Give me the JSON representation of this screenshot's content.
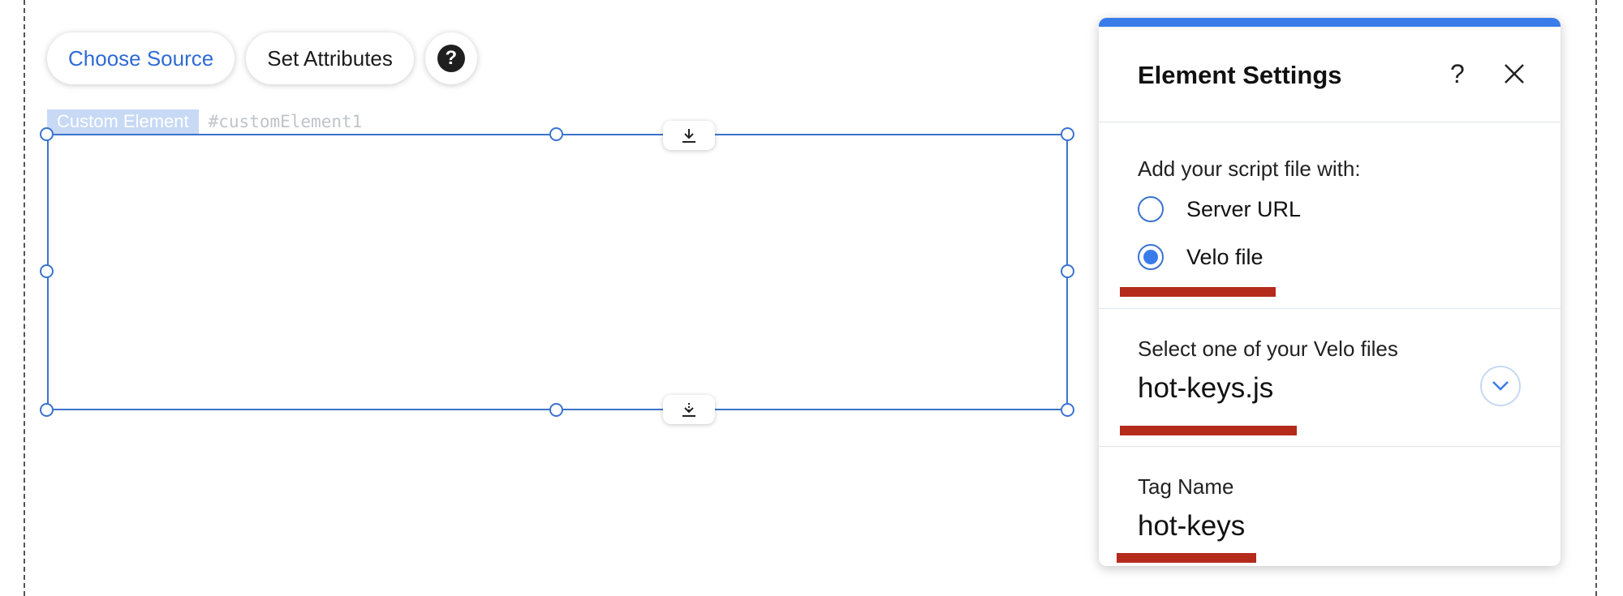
{
  "toolbar": {
    "choose_source_label": "Choose Source",
    "set_attributes_label": "Set Attributes",
    "help_icon": "question-circle-icon"
  },
  "element": {
    "type_label": "Custom Element",
    "id_label": "#customElement1"
  },
  "panel": {
    "title": "Element Settings",
    "help_label": "?",
    "script_section": {
      "label": "Add your script file with:",
      "options": [
        {
          "label": "Server URL",
          "selected": false
        },
        {
          "label": "Velo file",
          "selected": true
        }
      ]
    },
    "file_section": {
      "label": "Select one of your Velo files",
      "value": "hot-keys.js"
    },
    "tag_section": {
      "label": "Tag Name",
      "value": "hot-keys"
    }
  },
  "colors": {
    "accent": "#3a7bea",
    "selection_border": "#3b73cf",
    "link_text": "#2f6bd4",
    "annotation_underline": "#b42b1c"
  }
}
